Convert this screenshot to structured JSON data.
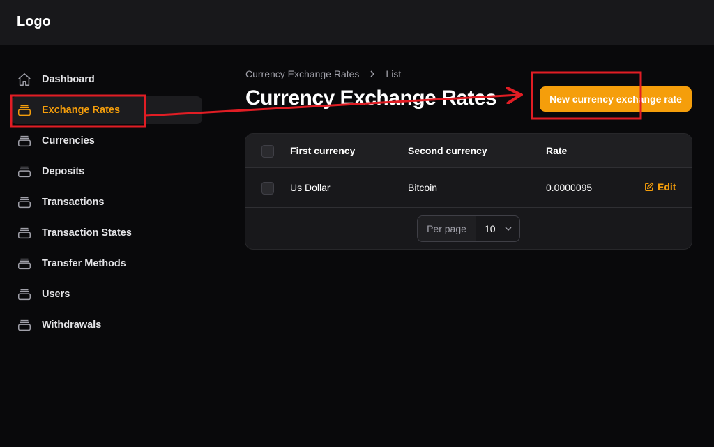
{
  "header": {
    "logo": "Logo"
  },
  "sidebar": {
    "items": [
      {
        "label": "Dashboard",
        "icon": "home-icon",
        "active": false
      },
      {
        "label": "Exchange Rates",
        "icon": "stack-icon",
        "active": true
      },
      {
        "label": "Currencies",
        "icon": "stack-icon",
        "active": false
      },
      {
        "label": "Deposits",
        "icon": "stack-icon",
        "active": false
      },
      {
        "label": "Transactions",
        "icon": "stack-icon",
        "active": false
      },
      {
        "label": "Transaction States",
        "icon": "stack-icon",
        "active": false
      },
      {
        "label": "Transfer Methods",
        "icon": "stack-icon",
        "active": false
      },
      {
        "label": "Users",
        "icon": "stack-icon",
        "active": false
      },
      {
        "label": "Withdrawals",
        "icon": "stack-icon",
        "active": false
      }
    ]
  },
  "breadcrumb": {
    "parent": "Currency Exchange Rates",
    "current": "List"
  },
  "page": {
    "title": "Currency Exchange Rates",
    "create_button": "New currency exchange rate"
  },
  "table": {
    "columns": [
      "First currency",
      "Second currency",
      "Rate"
    ],
    "rows": [
      {
        "first": "Us Dollar",
        "second": "Bitcoin",
        "rate": "0.0000095",
        "action": "Edit"
      }
    ]
  },
  "pagination": {
    "label": "Per page",
    "value": "10"
  },
  "colors": {
    "accent": "#f59e0b",
    "background": "#09090b",
    "annotation": "#e11d24"
  }
}
